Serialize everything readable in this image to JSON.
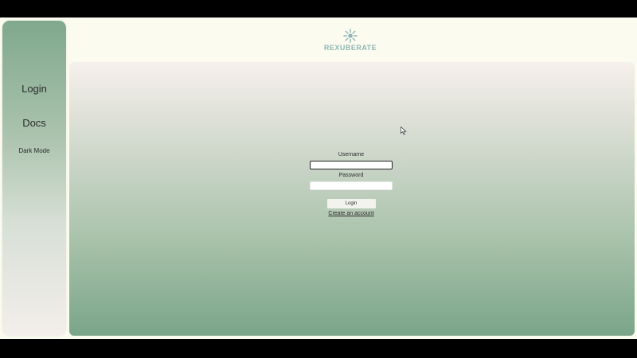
{
  "sidebar": {
    "items": [
      {
        "label": "Login"
      },
      {
        "label": "Docs"
      },
      {
        "label": "Dark Mode"
      }
    ]
  },
  "logo": {
    "text": "REXUBERATE",
    "icon": "sunburst-logo-icon",
    "color": "#8fb6b3"
  },
  "login_form": {
    "username_label": "Username",
    "username_value": "",
    "password_label": "Password",
    "password_value": "",
    "submit_label": "Login",
    "create_account_label": "Create an account"
  },
  "colors": {
    "sidebar_top": "#7fa88c",
    "main_bottom": "#7aa589",
    "page_background": "#fbfbf0"
  }
}
